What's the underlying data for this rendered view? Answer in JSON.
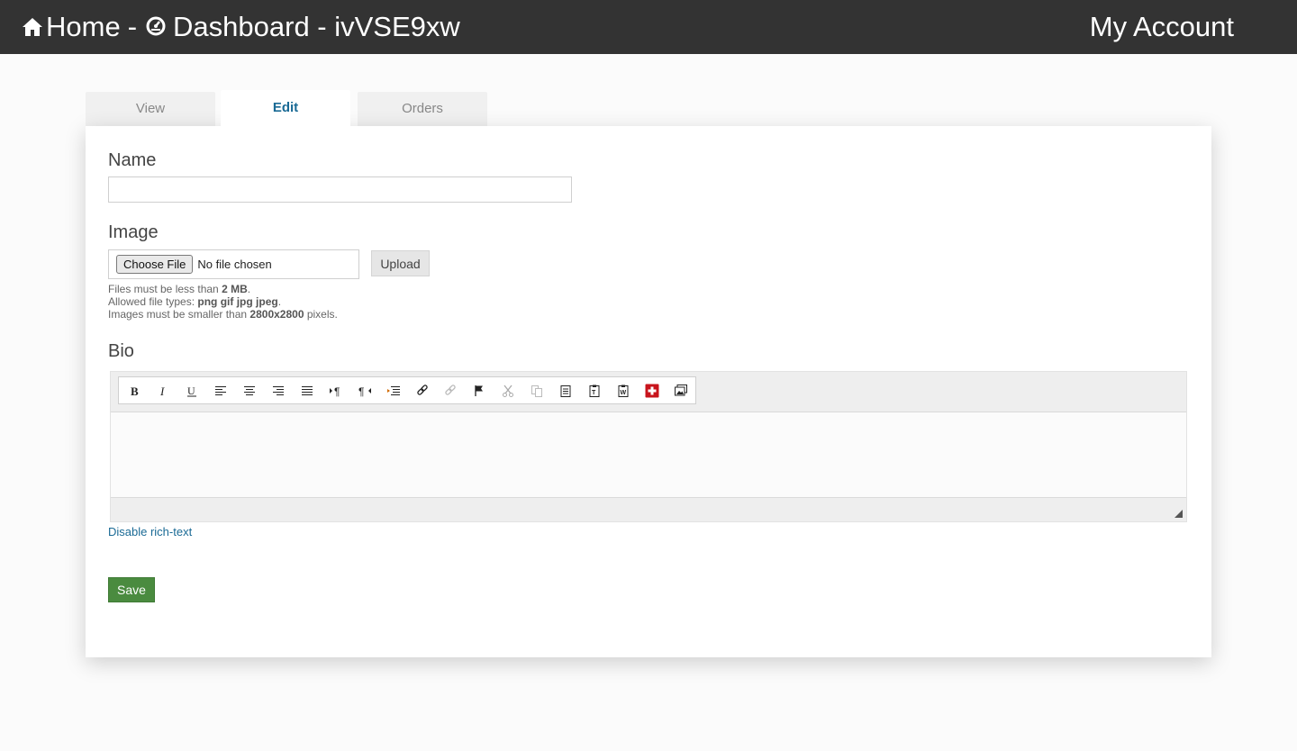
{
  "header": {
    "home_label": "Home",
    "separator": "-",
    "dashboard_label": "Dashboard - ivVSE9xw",
    "account_label": "My Account"
  },
  "tabs": [
    {
      "label": "View",
      "active": false
    },
    {
      "label": "Edit",
      "active": true
    },
    {
      "label": "Orders",
      "active": false
    }
  ],
  "form": {
    "name": {
      "label": "Name",
      "value": ""
    },
    "image": {
      "label": "Image",
      "choose_label": "Choose File",
      "file_status": "No file chosen",
      "upload_label": "Upload",
      "help": {
        "size_prefix": "Files must be less than",
        "size_value": "2 MB",
        "types_prefix": "Allowed file types:",
        "types_value": "png gif jpg jpeg",
        "dims_prefix": "Images must be smaller than",
        "dims_value": "2800x2800",
        "dims_suffix": "pixels."
      }
    },
    "bio": {
      "label": "Bio",
      "value": "",
      "toolbar": [
        "bold-icon",
        "italic-icon",
        "underline-icon",
        "align-left-icon",
        "align-center-icon",
        "align-right-icon",
        "justify-icon",
        "ltr-icon",
        "rtl-icon",
        "indent-icon",
        "link-icon",
        "unlink-icon",
        "anchor-icon",
        "cut-icon",
        "copy-icon",
        "paste-icon",
        "paste-text-icon",
        "paste-word-icon",
        "add-icon",
        "image-icon"
      ],
      "disable_label": "Disable rich-text"
    },
    "save_label": "Save"
  },
  "colors": {
    "header_bg": "#333333",
    "link": "#1a6a95",
    "save_bg": "#4a8b3f",
    "add_icon": "#c8141c"
  }
}
